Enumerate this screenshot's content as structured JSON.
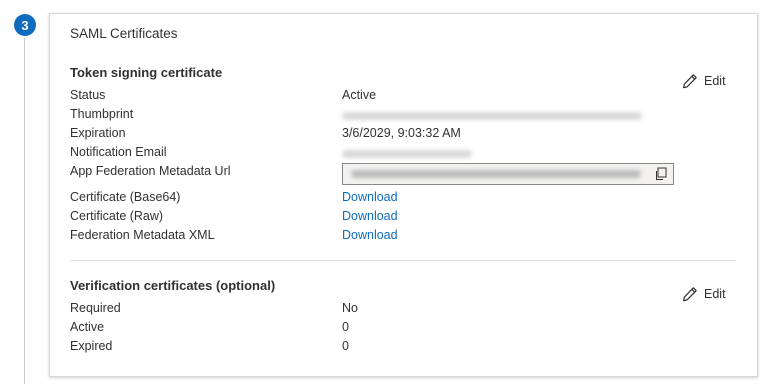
{
  "step": {
    "number": "3"
  },
  "card": {
    "title": "SAML Certificates",
    "token_signing": {
      "title": "Token signing certificate",
      "edit_label": "Edit",
      "rows": [
        {
          "label": "Status",
          "value": "Active"
        },
        {
          "label": "Thumbprint",
          "value": ""
        },
        {
          "label": "Expiration",
          "value": "3/6/2029, 9:03:32 AM"
        },
        {
          "label": "Notification Email",
          "value": ""
        },
        {
          "label": "App Federation Metadata Url",
          "value": ""
        },
        {
          "label": "Certificate (Base64)",
          "value": "Download"
        },
        {
          "label": "Certificate (Raw)",
          "value": "Download"
        },
        {
          "label": "Federation Metadata XML",
          "value": "Download"
        }
      ]
    },
    "verification": {
      "title": "Verification certificates (optional)",
      "edit_label": "Edit",
      "rows": [
        {
          "label": "Required",
          "value": "No"
        },
        {
          "label": "Active",
          "value": "0"
        },
        {
          "label": "Expired",
          "value": "0"
        }
      ]
    }
  },
  "icons": {
    "edit": "pencil-icon",
    "copy": "copy-icon"
  },
  "colors": {
    "accent": "#0f6cbd",
    "text": "#323130"
  }
}
